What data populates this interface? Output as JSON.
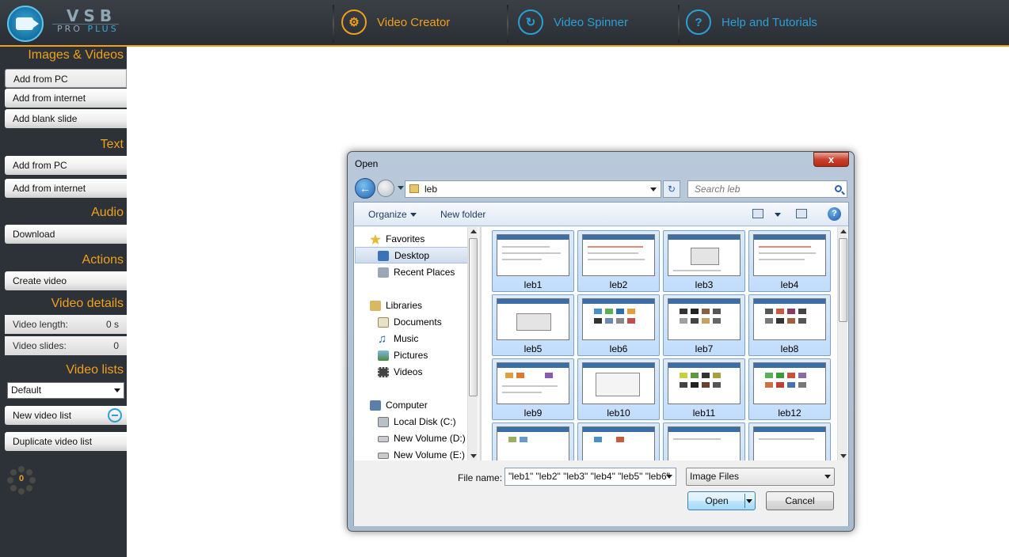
{
  "header": {
    "logo_main": "VSB",
    "logo_sub_a": "PRO ",
    "logo_sub_b": "PLUS",
    "nav": [
      {
        "label": "Video Creator",
        "icon": "gear-icon"
      },
      {
        "label": "Video Spinner",
        "icon": "refresh-icon"
      },
      {
        "label": "Help and Tutorials",
        "icon": "question-icon"
      }
    ],
    "accent": "#f0a01a",
    "blue": "#2aa0d4"
  },
  "sidebar": {
    "images_videos": {
      "title": "Images & Videos",
      "items": [
        "Add from PC",
        "Add from internet",
        "Add blank slide"
      ]
    },
    "text": {
      "title": "Text",
      "items": [
        "Add from PC",
        "Add from internet"
      ]
    },
    "audio": {
      "title": "Audio",
      "items": [
        "Download"
      ]
    },
    "actions": {
      "title": "Actions",
      "items": [
        "Create video"
      ]
    },
    "video_details": {
      "title": "Video details",
      "length_label": "Video length:",
      "length_value": "0 s",
      "slides_label": "Video slides:",
      "slides_value": "0"
    },
    "video_lists": {
      "title": "Video lists",
      "selected": "Default",
      "new_label": "New video list",
      "duplicate_label": "Duplicate video list"
    },
    "counter": "0"
  },
  "dialog": {
    "title": "Open",
    "close": "x",
    "address": "leb",
    "search_placeholder": "Search leb",
    "toolbar": {
      "organize": "Organize",
      "new_folder": "New folder",
      "help": "?"
    },
    "nav": {
      "favorites": "Favorites",
      "desktop": "Desktop",
      "recent": "Recent Places",
      "libraries": "Libraries",
      "documents": "Documents",
      "music": "Music",
      "pictures": "Pictures",
      "videos": "Videos",
      "computer": "Computer",
      "disk_c": "Local Disk (C:)",
      "vol_d": "New Volume (D:)",
      "vol_e": "New Volume (E:)"
    },
    "files": [
      "leb1",
      "leb2",
      "leb3",
      "leb4",
      "leb5",
      "leb6",
      "leb7",
      "leb8",
      "leb9",
      "leb10",
      "leb11",
      "leb12"
    ],
    "file_name_label": "File name:",
    "file_name_value": "\"leb1\" \"leb2\" \"leb3\" \"leb4\" \"leb5\" \"leb6\"",
    "file_type": "Image Files",
    "open_label": "Open",
    "cancel_label": "Cancel"
  }
}
